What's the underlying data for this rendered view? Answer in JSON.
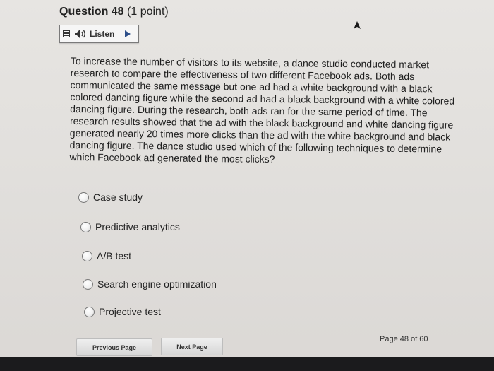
{
  "question": {
    "number_label": "Question 48",
    "points_label": "(1 point)",
    "text": "To increase the number of visitors to its website, a dance studio conducted market research to compare the effectiveness of two different Facebook ads. Both ads communicated the same message but one ad had a white background with a black colored dancing figure while the second ad had a black background with a white colored dancing figure. During the research, both ads ran for the same period of time. The research results showed that the ad with the black background and white dancing figure generated nearly 20 times more clicks than the ad with the white background and black dancing figure. The dance studio used which of the following techniques to determine which Facebook ad generated the most clicks?"
  },
  "listen_toolbar": {
    "label": "Listen",
    "icons": [
      "menu-icon",
      "speaker-icon",
      "play-icon"
    ]
  },
  "options": [
    {
      "label": "Case study",
      "selected": false
    },
    {
      "label": "Predictive analytics",
      "selected": false
    },
    {
      "label": "A/B test",
      "selected": false
    },
    {
      "label": "Search engine optimization",
      "selected": false
    },
    {
      "label": "Projective test",
      "selected": false
    }
  ],
  "navigation": {
    "previous_label": "Previous Page",
    "next_label": "Next Page",
    "page_indicator": "Page 48 of 60"
  }
}
